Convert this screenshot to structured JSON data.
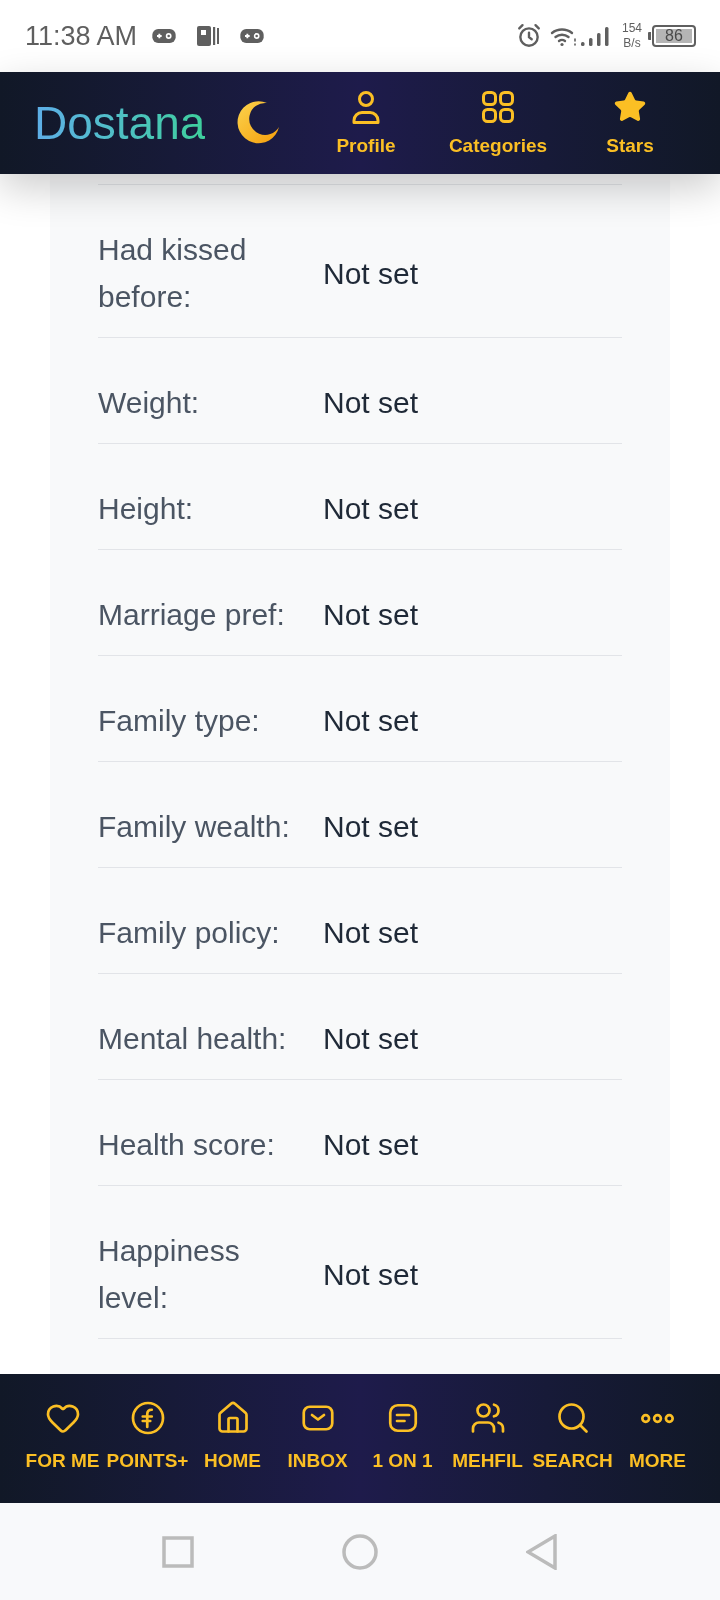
{
  "status_bar": {
    "time": "11:38 AM",
    "network_speed": "154",
    "network_speed_unit": "B/s",
    "battery": "86"
  },
  "header": {
    "logo": "Dostana",
    "nav": [
      {
        "label": "Profile"
      },
      {
        "label": "Categories"
      },
      {
        "label": "Stars"
      }
    ]
  },
  "profile_fields": [
    {
      "label": "Had kissed before:",
      "value": "Not set"
    },
    {
      "label": "Weight:",
      "value": "Not set"
    },
    {
      "label": "Height:",
      "value": "Not set"
    },
    {
      "label": "Marriage pref:",
      "value": "Not set"
    },
    {
      "label": "Family type:",
      "value": "Not set"
    },
    {
      "label": "Family wealth:",
      "value": "Not set"
    },
    {
      "label": "Family policy:",
      "value": "Not set"
    },
    {
      "label": "Mental health:",
      "value": "Not set"
    },
    {
      "label": "Health score:",
      "value": "Not set"
    },
    {
      "label": "Happiness level:",
      "value": "Not set"
    }
  ],
  "bottom_nav": [
    {
      "label": "FOR ME"
    },
    {
      "label": "POINTS+"
    },
    {
      "label": "HOME"
    },
    {
      "label": "INBOX"
    },
    {
      "label": "1 ON 1"
    },
    {
      "label": "MEHFIL"
    },
    {
      "label": "SEARCH"
    },
    {
      "label": "MORE"
    }
  ]
}
